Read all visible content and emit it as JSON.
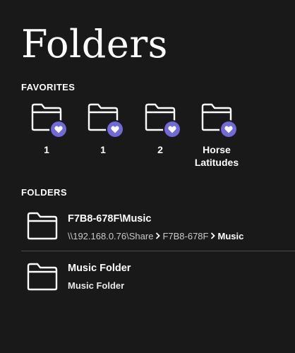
{
  "page": {
    "title": "Folders"
  },
  "colors": {
    "background": "#1a191a",
    "accent": "#6f6ad8",
    "text": "#ffffff",
    "muted_text": "#c9c9cb",
    "divider": "#4a494b"
  },
  "favorites": {
    "header": "FAVORITES",
    "items": [
      {
        "label": "1",
        "icon": "folder-icon",
        "badge_icon": "heart-icon"
      },
      {
        "label": "1",
        "icon": "folder-icon",
        "badge_icon": "heart-icon"
      },
      {
        "label": "2",
        "icon": "folder-icon",
        "badge_icon": "heart-icon"
      },
      {
        "label": "Horse Latitudes",
        "icon": "folder-icon",
        "badge_icon": "heart-icon"
      }
    ]
  },
  "folders": {
    "header": "FOLDERS",
    "items": [
      {
        "title": "F7B8-678F\\Music",
        "icon": "folder-icon",
        "path": {
          "segments": [
            "\\\\192.168.0.76\\Share",
            "F7B8-678F",
            "Music"
          ],
          "separator_icon": "chevron-right-icon"
        }
      },
      {
        "title": "Music Folder",
        "icon": "folder-icon",
        "subtitle": "Music Folder"
      }
    ]
  }
}
